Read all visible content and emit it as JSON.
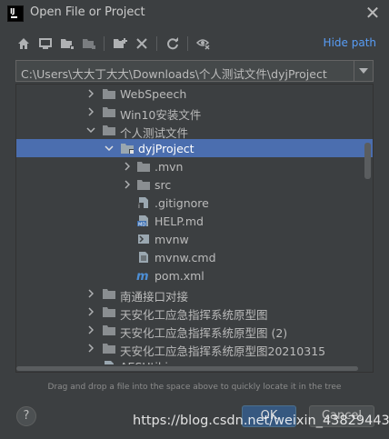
{
  "window": {
    "title": "Open File or Project"
  },
  "toolbar": {
    "icons": [
      "home-icon",
      "desktop-icon",
      "project-folder-icon",
      "module-folder-icon",
      "new-folder-icon",
      "delete-icon",
      "refresh-icon",
      "show-hidden-icon"
    ],
    "hide_path_label": "Hide path"
  },
  "path": {
    "value": "C:\\Users\\大大丁大大\\Downloads\\个人测试文件\\dyjProject"
  },
  "tree": {
    "items": [
      {
        "label": "WebSpeech",
        "expanded": false,
        "icon": "folder-icon"
      },
      {
        "label": "Win10安装文件",
        "expanded": false,
        "icon": "folder-icon"
      },
      {
        "label": "个人测试文件",
        "expanded": true,
        "icon": "folder-icon"
      },
      {
        "label": "dyjProject",
        "expanded": true,
        "icon": "folder-icon",
        "selected": true
      },
      {
        "label": ".mvn",
        "expanded": false,
        "icon": "folder-icon"
      },
      {
        "label": "src",
        "expanded": false,
        "icon": "folder-icon"
      },
      {
        "label": ".gitignore",
        "icon": "gitignore-file-icon"
      },
      {
        "label": "HELP.md",
        "icon": "markdown-file-icon"
      },
      {
        "label": "mvnw",
        "icon": "shell-file-icon"
      },
      {
        "label": "mvnw.cmd",
        "icon": "text-file-icon"
      },
      {
        "label": "pom.xml",
        "icon": "maven-file-icon"
      },
      {
        "label": "南通接口对接",
        "expanded": false,
        "icon": "folder-icon"
      },
      {
        "label": "天安化工应急指挥系统原型图",
        "expanded": false,
        "icon": "folder-icon"
      },
      {
        "label": "天安化工应急指挥系统原型图 (2)",
        "expanded": false,
        "icon": "folder-icon"
      },
      {
        "label": "天安化工应急指挥系统原型图20210315",
        "expanded": false,
        "icon": "folder-icon"
      },
      {
        "label": "AESUtil.java",
        "icon": "java-file-icon"
      }
    ]
  },
  "hint": "Drag and drop a file into the space above to quickly locate it in the tree",
  "footer": {
    "help_label": "?",
    "ok_label": "OK",
    "cancel_label": "Cancel"
  },
  "watermark": "https://blog.csdn.net/weixin_43829443",
  "colors": {
    "selection": "#4b6eaf",
    "link": "#589df6",
    "background": "#3c3f41"
  }
}
